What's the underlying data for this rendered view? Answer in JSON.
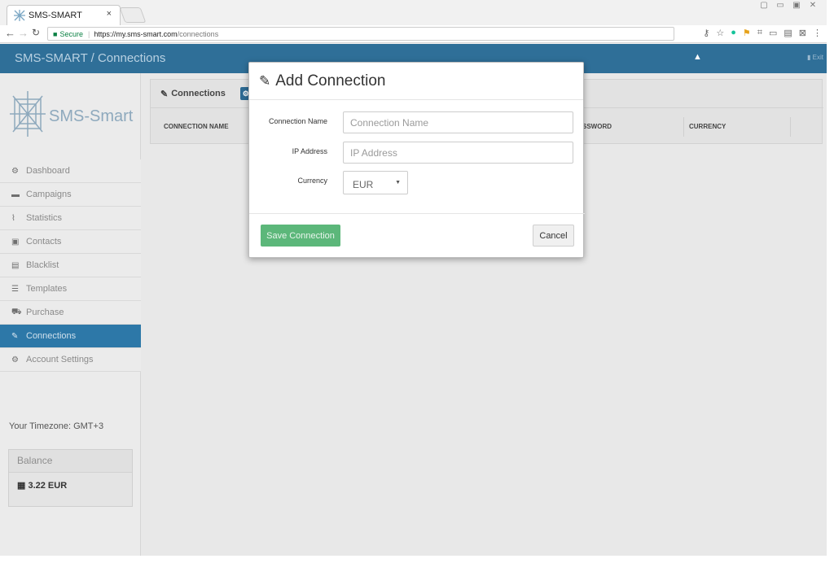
{
  "browser": {
    "tab_title": "SMS-SMART",
    "tab_close": "×",
    "secure_label": "Secure",
    "url_host": "https://my.sms-smart.com",
    "url_path": "/connections"
  },
  "topbar": {
    "title": "SMS-SMART / Connections",
    "exit_label": "Exit"
  },
  "sidebar": {
    "logo_text": "SMS-Smart",
    "items": [
      {
        "label": "Dashboard",
        "icon": "dashboard-icon",
        "glyph": "⚙"
      },
      {
        "label": "Campaigns",
        "icon": "campaigns-icon",
        "glyph": "▬"
      },
      {
        "label": "Statistics",
        "icon": "statistics-icon",
        "glyph": "⌇"
      },
      {
        "label": "Contacts",
        "icon": "contacts-icon",
        "glyph": "▣"
      },
      {
        "label": "Blacklist",
        "icon": "blacklist-icon",
        "glyph": "▤"
      },
      {
        "label": "Templates",
        "icon": "templates-icon",
        "glyph": "☰"
      },
      {
        "label": "Purchase",
        "icon": "cart-icon",
        "glyph": "⛟"
      },
      {
        "label": "Connections",
        "icon": "connections-icon",
        "glyph": "✎",
        "active": true
      },
      {
        "label": "Account Settings",
        "icon": "settings-icon",
        "glyph": "⚙"
      }
    ],
    "timezone": "Your Timezone: GMT+3",
    "balance_title": "Balance",
    "balance_value": "3.22 EUR"
  },
  "panel": {
    "title": "Connections",
    "columns": [
      "CONNECTION NAME",
      "SSWORD",
      "CURRENCY"
    ]
  },
  "modal": {
    "title": "Add Connection",
    "fields": {
      "connection_name_label": "Connection Name",
      "connection_name_placeholder": "Connection Name",
      "ip_label": "IP Address",
      "ip_placeholder": "IP Address",
      "currency_label": "Currency",
      "currency_value": "EUR"
    },
    "save_label": "Save Connection",
    "cancel_label": "Cancel"
  },
  "colors": {
    "topbar": "#2f6f98",
    "active_menu": "#2d78a8",
    "save_button": "#5cb77a"
  }
}
